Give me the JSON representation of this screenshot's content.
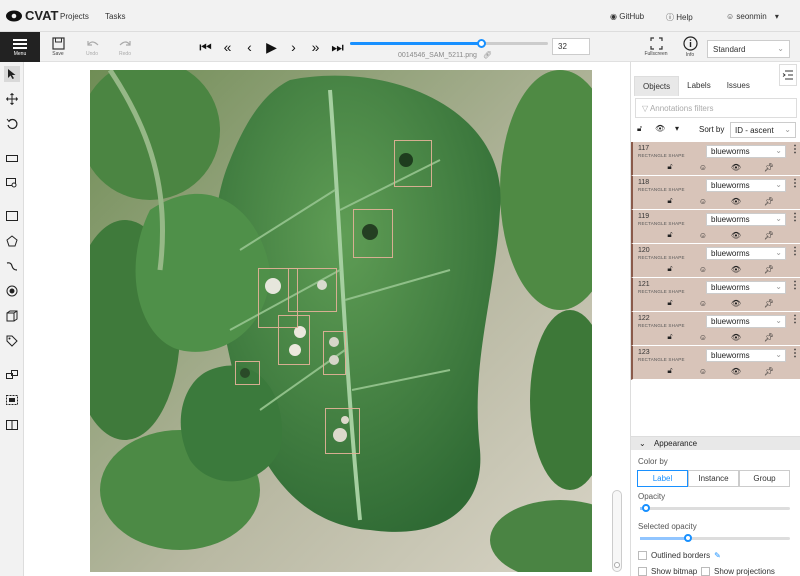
{
  "app": {
    "name": "CVAT"
  },
  "nav": {
    "projects": "Projects",
    "tasks": "Tasks",
    "github": "GitHub",
    "help": "Help",
    "user": "seonmin"
  },
  "toolbar": {
    "menu": "Menu",
    "save": "Save",
    "undo": "Undo",
    "redo": "Redo",
    "fullscreen": "Fullscreen",
    "info": "Info",
    "workspace": "Standard"
  },
  "player": {
    "frame": "32",
    "filename": "0014546_SAM_5211.png",
    "progress": 0.66
  },
  "panel": {
    "tabs": [
      "Objects",
      "Labels",
      "Issues"
    ],
    "filter_placeholder": "Annotations filters",
    "sort_label": "Sort by",
    "sort_value": "ID - ascent",
    "objects": [
      {
        "id": "117",
        "shape": "RECTANGLE SHAPE",
        "label": "blueworms"
      },
      {
        "id": "118",
        "shape": "RECTANGLE SHAPE",
        "label": "blueworms"
      },
      {
        "id": "119",
        "shape": "RECTANGLE SHAPE",
        "label": "blueworms"
      },
      {
        "id": "120",
        "shape": "RECTANGLE SHAPE",
        "label": "blueworms"
      },
      {
        "id": "121",
        "shape": "RECTANGLE SHAPE",
        "label": "blueworms"
      },
      {
        "id": "122",
        "shape": "RECTANGLE SHAPE",
        "label": "blueworms"
      },
      {
        "id": "123",
        "shape": "RECTANGLE SHAPE",
        "label": "blueworms"
      }
    ],
    "appearance": {
      "title": "Appearance",
      "color_by": "Color by",
      "color_options": [
        "Label",
        "Instance",
        "Group"
      ],
      "opacity": "Opacity",
      "opacity_value": 0.04,
      "selected_opacity": "Selected opacity",
      "selected_opacity_value": 0.32,
      "outlined_borders": "Outlined borders",
      "show_bitmap": "Show bitmap",
      "show_projections": "Show projections"
    }
  },
  "colors": {
    "accent": "#1890ff",
    "object_row": "#d8c4b9",
    "bbox": "#deb096"
  }
}
